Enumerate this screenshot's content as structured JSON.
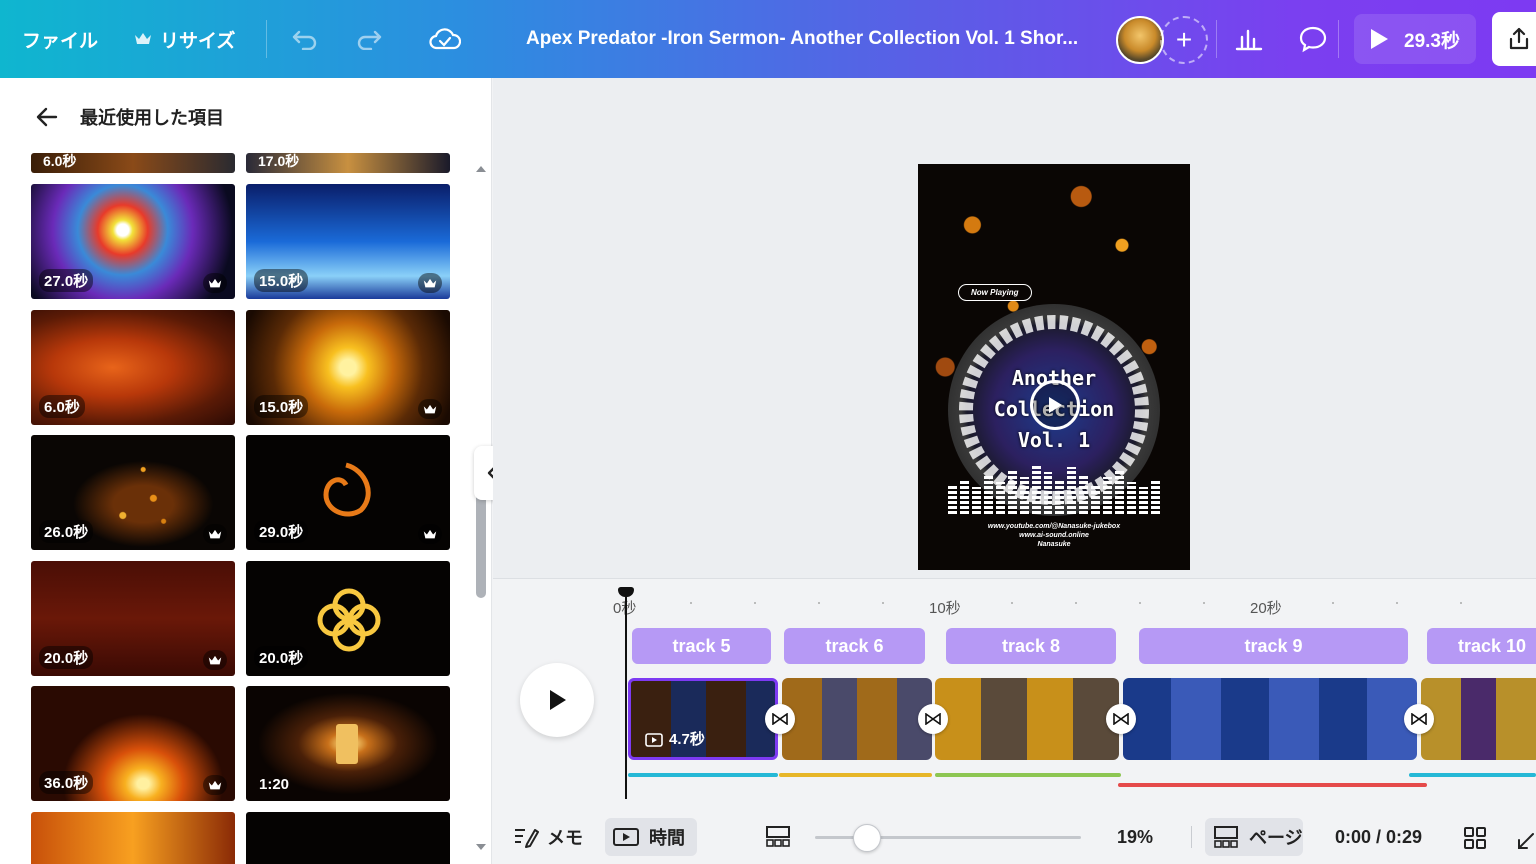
{
  "topbar": {
    "file_label": "ファイル",
    "resize_label": "リサイズ",
    "title": "Apex Predator -Iron Sermon- Another Collection Vol. 1 Shor...",
    "present_label": "29.3秒",
    "plus": "+"
  },
  "left_panel": {
    "title": "最近使用した項目",
    "top_partial": [
      "6.0秒",
      "17.0秒"
    ],
    "thumbnails": [
      {
        "duration": "27.0秒",
        "premium": true
      },
      {
        "duration": "15.0秒",
        "premium": true
      },
      {
        "duration": "6.0秒",
        "premium": false
      },
      {
        "duration": "15.0秒",
        "premium": true
      },
      {
        "duration": "26.0秒",
        "premium": true
      },
      {
        "duration": "29.0秒",
        "premium": true
      },
      {
        "duration": "20.0秒",
        "premium": true
      },
      {
        "duration": "20.0秒",
        "premium": false
      },
      {
        "duration": "36.0秒",
        "premium": true
      },
      {
        "duration": "1:20",
        "premium": false
      }
    ]
  },
  "preview": {
    "now_playing": "Now Playing",
    "disc_line1": "Another",
    "disc_line2": "Collection",
    "disc_line3": "Vol. 1",
    "credit1": "www.youtube.com/@Nanasuke-jukebox",
    "credit2": "www.ai-sound.online",
    "credit3": "Nanasuke"
  },
  "timeline": {
    "ruler": [
      "0秒",
      "10秒",
      "20秒"
    ],
    "tracks": [
      "track 5",
      "track 6",
      "track 8",
      "track 9",
      "track 10"
    ],
    "selected_clip_duration": "4.7秒",
    "underline_colors": [
      "#25b8d6",
      "#e7b628",
      "#8dc652",
      "#e54a4a",
      "#25b8d6"
    ]
  },
  "bottombar": {
    "notes_label": "メモ",
    "time_label": "時間",
    "zoom": "19%",
    "page_label": "ページ",
    "timecode": "0:00 / 0:29"
  }
}
